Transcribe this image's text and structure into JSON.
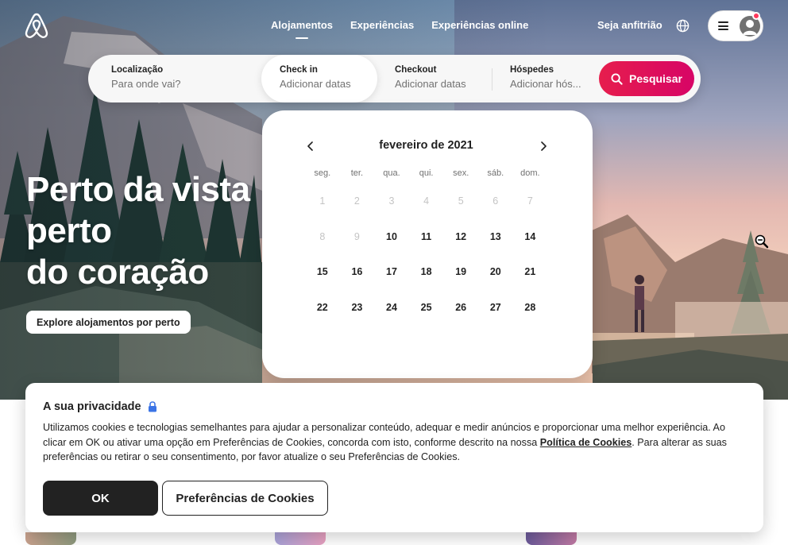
{
  "colors": {
    "brand": "#ff385c",
    "search_gradient_start": "#e61e4d",
    "search_gradient_end": "#d70466",
    "text": "#222222",
    "muted": "#717171"
  },
  "header": {
    "logo_icon": "airbnb-logo-icon",
    "tabs": [
      {
        "label": "Alojamentos",
        "active": true
      },
      {
        "label": "Experiências",
        "active": false
      },
      {
        "label": "Experiências online",
        "active": false
      }
    ],
    "host_link": "Seja anfitrião",
    "language_icon": "globe-icon",
    "menu_icon": "hamburger-icon",
    "profile_icon": "user-avatar-icon"
  },
  "search": {
    "location": {
      "label": "Localização",
      "placeholder": "Para onde vai?"
    },
    "check_in": {
      "label": "Check in",
      "placeholder": "Adicionar datas"
    },
    "check_out": {
      "label": "Checkout",
      "placeholder": "Adicionar datas"
    },
    "guests": {
      "label": "Hóspedes",
      "placeholder": "Adicionar hós..."
    },
    "button_label": "Pesquisar",
    "button_icon": "search-icon"
  },
  "hero": {
    "headline_lines": [
      "Perto da vista",
      "perto",
      "do coração"
    ],
    "explore_button": "Explore alojamentos por perto"
  },
  "calendar": {
    "month": "fevereiro de 2021",
    "prev_icon": "chevron-left-icon",
    "next_icon": "chevron-right-icon",
    "weekdays": [
      "seg.",
      "ter.",
      "qua.",
      "qui.",
      "sex.",
      "sáb.",
      "dom."
    ],
    "weeks": [
      [
        "1",
        "2",
        "3",
        "4",
        "5",
        "6",
        "7"
      ],
      [
        "8",
        "9",
        "10",
        "11",
        "12",
        "13",
        "14"
      ],
      [
        "15",
        "16",
        "17",
        "18",
        "19",
        "20",
        "21"
      ],
      [
        "22",
        "23",
        "24",
        "25",
        "26",
        "27",
        "28"
      ]
    ],
    "disabled_days": [
      "1",
      "2",
      "3",
      "4",
      "5",
      "6",
      "7",
      "8",
      "9"
    ]
  },
  "cookie_banner": {
    "title": "A sua privacidade",
    "title_icon": "lock-icon",
    "text_before_link": "Utilizamos cookies e tecnologias semelhantes para ajudar a personalizar conteúdo, adequar e medir anúncios e proporcionar uma melhor experiência. Ao clicar em OK ou ativar uma opção em Preferências de Cookies, concorda com isto, conforme descrito na nossa ",
    "link_text": "Política de Cookies",
    "text_after_link": ". Para alterar as suas preferências ou retirar o seu consentimento, por favor atualize o seu Preferências de Cookies.",
    "ok_button": "OK",
    "preferences_button": "Preferências de Cookies"
  },
  "cursor_icon": "zoom-out-icon"
}
